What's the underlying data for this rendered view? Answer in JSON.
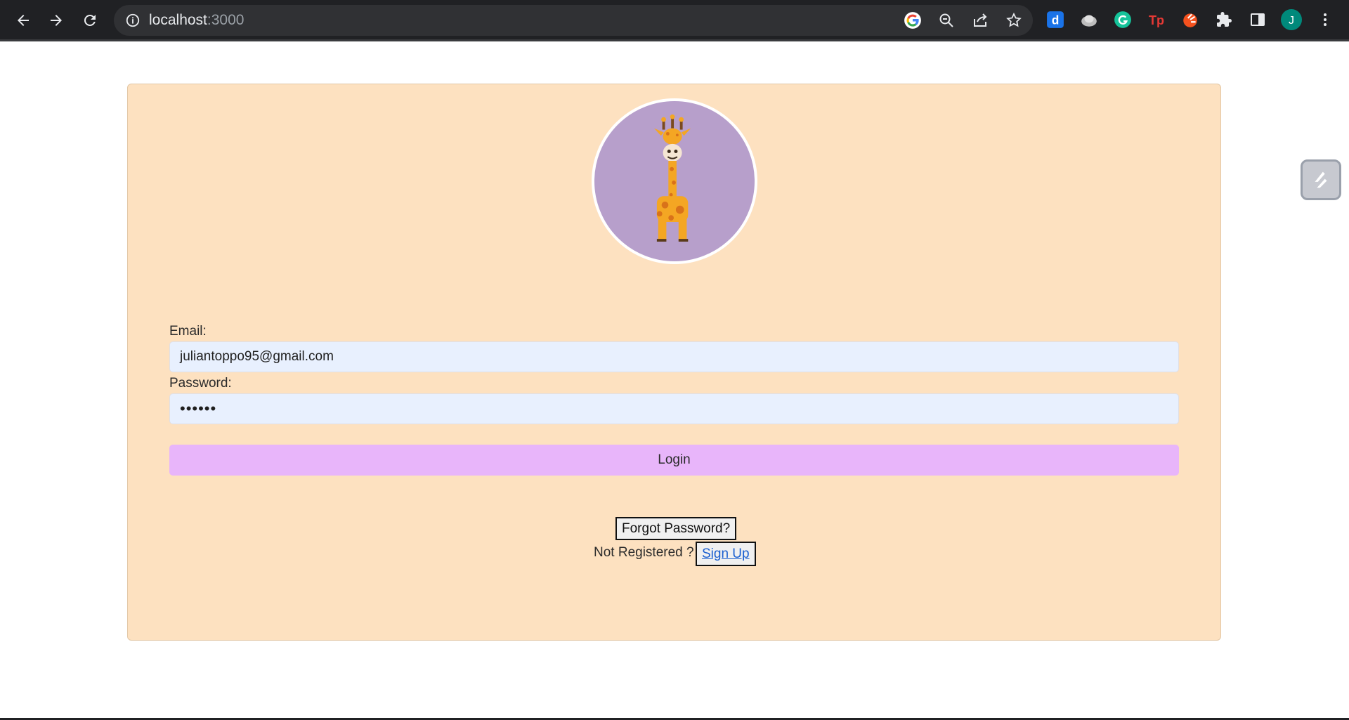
{
  "browser": {
    "url_host": "localhost",
    "url_port": ":3000",
    "profile_initial": "J",
    "icons": {
      "back": "arrow-left-icon",
      "forward": "arrow-right-icon",
      "reload": "reload-icon",
      "info": "info-icon",
      "google": "google-icon",
      "zoom": "zoom-out-icon",
      "share": "share-icon",
      "bookmark": "star-icon",
      "extensions": "puzzle-icon",
      "side_panel": "side-panel-icon",
      "menu": "kebab-menu-icon"
    },
    "extension_badges": [
      "d",
      "Tp"
    ]
  },
  "login": {
    "email_label": "Email:",
    "email_value": "juliantoppo95@gmail.com",
    "password_label": "Password:",
    "password_value": "••••••",
    "login_button": "Login",
    "forgot_button": "Forgot Password?",
    "not_registered": "Not Registered ?",
    "signup_link": "Sign Up"
  },
  "colors": {
    "card_bg": "#fde1c0",
    "avatar_bg": "#b79fcb",
    "login_button_bg": "#e8b5fa",
    "input_bg": "#e8f0fe",
    "link": "#1a5fd0"
  }
}
